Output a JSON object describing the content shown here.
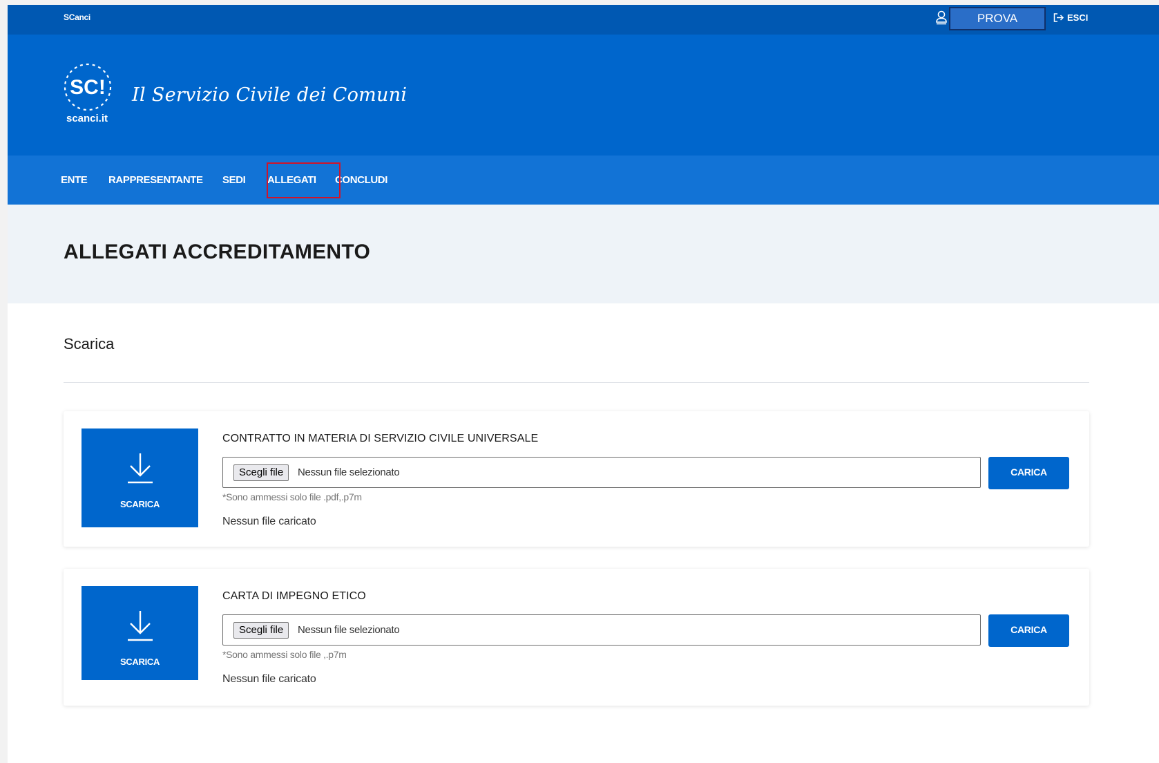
{
  "topbar": {
    "brand": "SCanci",
    "user_name": "PROVA",
    "logout_label": "ESCI"
  },
  "header": {
    "logo_badge": "SC!",
    "logo_caption": "scanci.it",
    "site_title": "Il Servizio Civile dei Comuni"
  },
  "nav": {
    "items": [
      {
        "label": "ENTE"
      },
      {
        "label": "RAPPRESENTANTE"
      },
      {
        "label": "SEDI"
      },
      {
        "label": "ALLEGATI"
      },
      {
        "label": "CONCLUDI"
      }
    ],
    "active_item": "ALLEGATI"
  },
  "page": {
    "title": "ALLEGATI ACCREDITAMENTO",
    "section_title": "Scarica"
  },
  "documents": [
    {
      "download_label": "SCARICA",
      "title": "CONTRATTO IN MATERIA DI SERVIZIO CIVILE UNIVERSALE",
      "choose_file_label": "Scegli file",
      "no_file_selected": "Nessun file selezionato",
      "upload_label": "CARICA",
      "hint": "*Sono ammessi solo file .pdf,.p7m",
      "status": "Nessun file caricato"
    },
    {
      "download_label": "SCARICA",
      "title": "CARTA DI IMPEGNO ETICO",
      "choose_file_label": "Scegli file",
      "no_file_selected": "Nessun file selezionato",
      "upload_label": "CARICA",
      "hint": "*Sono ammessi solo file ,.p7m",
      "status": "Nessun file caricato"
    }
  ],
  "colors": {
    "topbar": "#0058b2",
    "header": "#0066cc",
    "nav": "#1273d6",
    "active_outline": "#d0142a",
    "title_band": "#eef3f8"
  },
  "icons": {
    "user": "user-icon",
    "logout": "logout-icon",
    "download": "download-icon"
  }
}
